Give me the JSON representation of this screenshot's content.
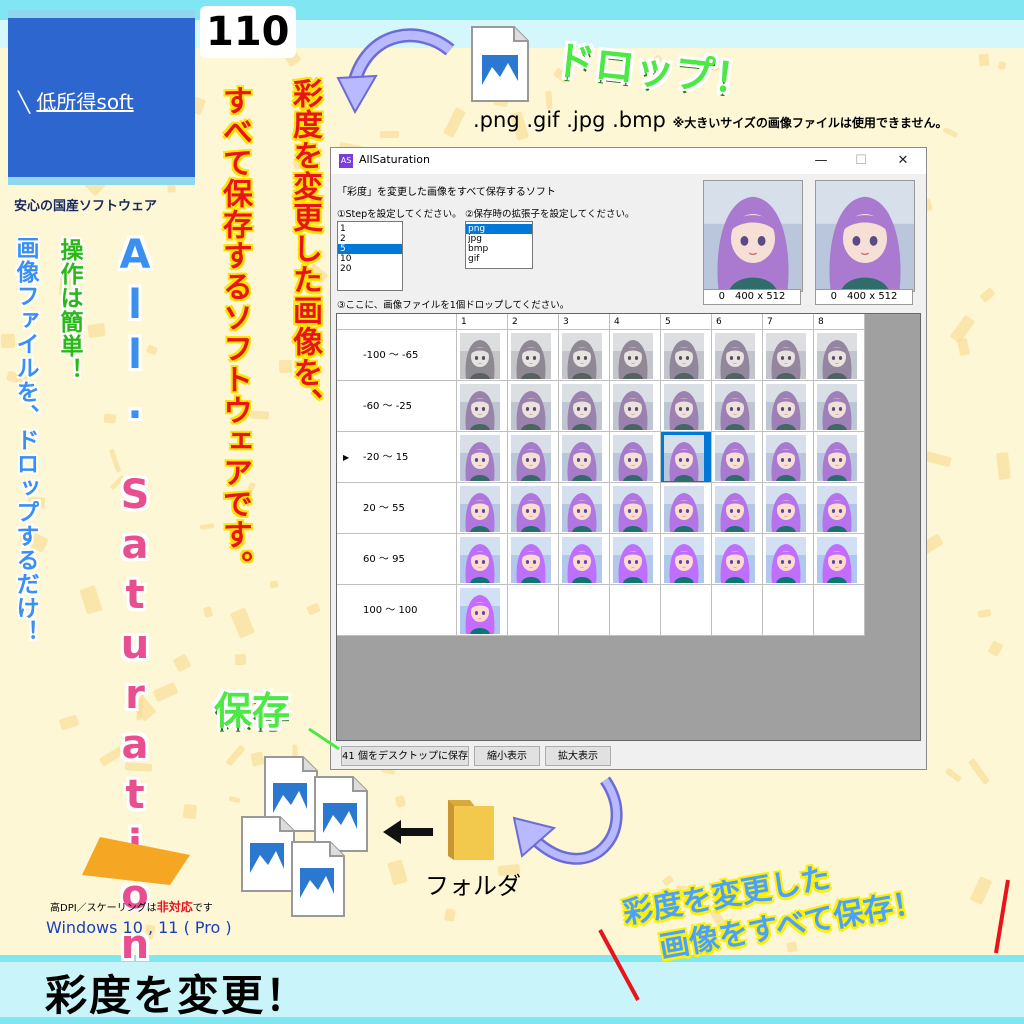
{
  "logo": {
    "glyph": "╲",
    "name": "低所得soft"
  },
  "tagline": "安心の国産ソフトウェア",
  "number": "110",
  "vertical": {
    "title": "彩度を変更した画像を、",
    "sub": "すべて保存するソフトウェアです。",
    "blue": "画像ファイルを、ドロップするだけ！",
    "green": "操作は簡単！"
  },
  "product_name_top": [
    "A",
    "l",
    "l",
    "."
  ],
  "product_name_bottom": [
    "S",
    "a",
    "t",
    "u",
    "r",
    "a",
    "t",
    "i",
    "o",
    "n"
  ],
  "drop_label": "ドロップ！",
  "extensions": ".png .gif .jpg .bmp",
  "extensions_note": "※大きいサイズの画像ファイルは使用できません。",
  "window": {
    "icon": "AS",
    "title": "AllSaturation",
    "controls": {
      "minimize": "—",
      "maximize": "☐",
      "close": "✕"
    },
    "description": "「彩度」を変更した画像をすべて保存するソフト",
    "step_label": "①Stepを設定してください。",
    "ext_label": "②保存時の拡張子を設定してください。",
    "drop_instruction": "③ここに、画像ファイルを1個ドロップしてください。",
    "step_options": [
      "1",
      "2",
      "5",
      "10",
      "20"
    ],
    "step_selected": "5",
    "ext_options": [
      "png",
      "jpg",
      "bmp",
      "gif"
    ],
    "ext_selected": "png",
    "preview_sizes": [
      "0　400 x 512",
      "0　400 x 512"
    ],
    "columns": [
      "1",
      "2",
      "3",
      "4",
      "5",
      "6",
      "7",
      "8"
    ],
    "rows": [
      {
        "label": "-100 ～ -65",
        "count": 8,
        "sat": 0.1
      },
      {
        "label": "-60 ～ -25",
        "count": 8,
        "sat": 0.45
      },
      {
        "label": "-20 ～ 15",
        "count": 8,
        "sat": 0.85
      },
      {
        "label": "20 ～ 55",
        "count": 8,
        "sat": 1.2
      },
      {
        "label": "60 ～ 95",
        "count": 8,
        "sat": 1.6
      },
      {
        "label": "100 ～ 100",
        "count": 1,
        "sat": 1.9
      }
    ],
    "current_row_marker": "▶",
    "buttons": {
      "save": "41 個をデスクトップに保存",
      "shrink": "縮小表示",
      "enlarge": "拡大表示"
    }
  },
  "save_label": "保存",
  "folder_label": "フォルダ",
  "dpi_prefix": "高DPI／スケーリングは",
  "dpi_bold": "非対応",
  "dpi_suffix": "です",
  "os": "Windows 10 , 11 ( Pro )",
  "bottom_title": "彩度を変更！",
  "banner": [
    "彩度を変更した",
    "画像をすべて保存！"
  ],
  "colors": {
    "accent_blue": "#2e66d0",
    "select": "#0078d7",
    "green": "#4ce844",
    "red": "#e8131b"
  }
}
